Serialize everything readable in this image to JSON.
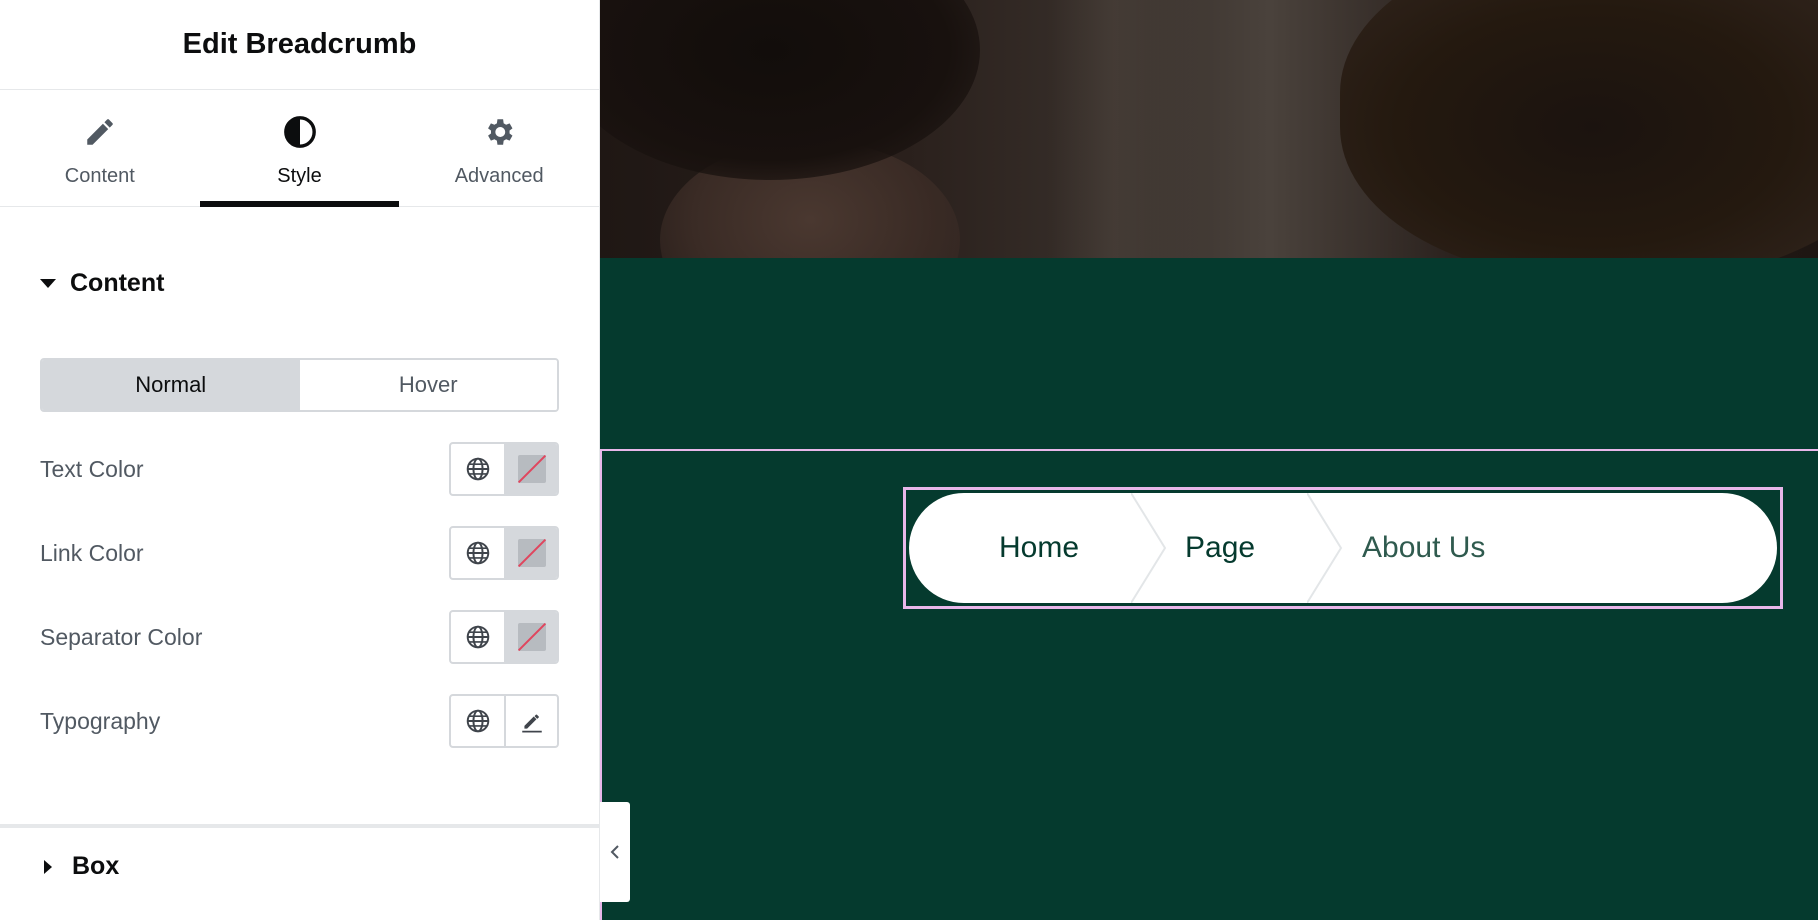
{
  "panel": {
    "title": "Edit Breadcrumb",
    "tabs": [
      {
        "label": "Content",
        "icon": "pencil-icon"
      },
      {
        "label": "Style",
        "icon": "contrast-icon",
        "active": true
      },
      {
        "label": "Advanced",
        "icon": "gear-icon"
      }
    ],
    "content_section": {
      "title": "Content",
      "switcher": {
        "normal": "Normal",
        "hover": "Hover",
        "active": "Normal"
      },
      "controls": [
        {
          "label": "Text Color",
          "type": "color"
        },
        {
          "label": "Link Color",
          "type": "color"
        },
        {
          "label": "Separator Color",
          "type": "color"
        },
        {
          "label": "Typography",
          "type": "typography"
        }
      ]
    },
    "box_section": {
      "title": "Box"
    }
  },
  "preview": {
    "breadcrumb": {
      "items": [
        {
          "label": "Home",
          "link": true
        },
        {
          "label": "Page",
          "link": true
        },
        {
          "label": "About Us",
          "link": false
        }
      ]
    }
  },
  "colors": {
    "accent_dark": "#0c0d0e",
    "preview_bg": "#053a2e",
    "selection_outline": "#e8b7ea",
    "unset_swatch_slash": "#e0465e"
  }
}
